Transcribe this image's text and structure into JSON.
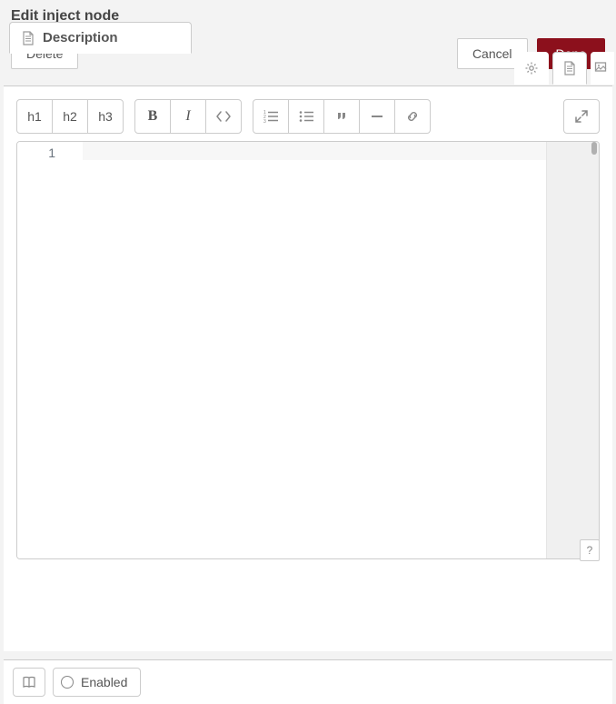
{
  "title": "Edit inject node",
  "buttons": {
    "delete": "Delete",
    "cancel": "Cancel",
    "done": "Done"
  },
  "tab": {
    "description": "Description"
  },
  "toolbar": {
    "h1": "h1",
    "h2": "h2",
    "h3": "h3",
    "bold": "B",
    "italic": "I"
  },
  "editor": {
    "line_numbers": [
      "1"
    ]
  },
  "help": {
    "label": "?"
  },
  "footer": {
    "enabled": "Enabled"
  }
}
